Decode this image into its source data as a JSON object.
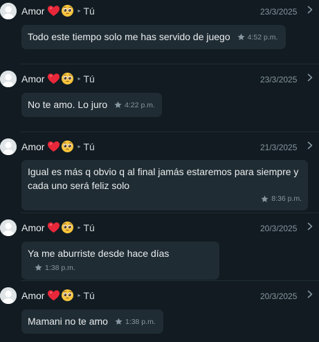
{
  "messages": [
    {
      "sender": "Amor",
      "emojis": [
        "heart-emoji",
        "pleading-face-emoji"
      ],
      "recipient": "Tú",
      "date": "23/3/2025",
      "text": "Todo este tiempo solo me has servido de juego",
      "time": "4:52 p.m.",
      "starred": true
    },
    {
      "sender": "Amor",
      "emojis": [
        "heart-emoji",
        "pleading-face-emoji"
      ],
      "recipient": "Tú",
      "date": "23/3/2025",
      "text": "No te amo. Lo juro",
      "time": "4:22 p.m.",
      "starred": true
    },
    {
      "sender": "Amor",
      "emojis": [
        "heart-emoji",
        "pleading-face-emoji"
      ],
      "recipient": "Tú",
      "date": "21/3/2025",
      "text": "Igual es más q obvio q al final jamás estaremos para siempre y cada uno será feliz solo",
      "time": "8:36 p.m.",
      "starred": true
    },
    {
      "sender": "Amor",
      "emojis": [
        "heart-emoji",
        "pleading-face-emoji"
      ],
      "recipient": "Tú",
      "date": "20/3/2025",
      "text": "Ya me aburriste desde hace días",
      "time": "1:38 p.m.",
      "starred": true
    },
    {
      "sender": "Amor",
      "emojis": [
        "heart-emoji",
        "pleading-face-emoji"
      ],
      "recipient": "Tú",
      "date": "20/3/2025",
      "text": "Mamani no te amo",
      "time": "1:38 p.m.",
      "starred": true
    }
  ],
  "colors": {
    "background": "#111b21",
    "bubble": "#202c33",
    "muted": "#8696a0",
    "text": "#e9edef"
  }
}
